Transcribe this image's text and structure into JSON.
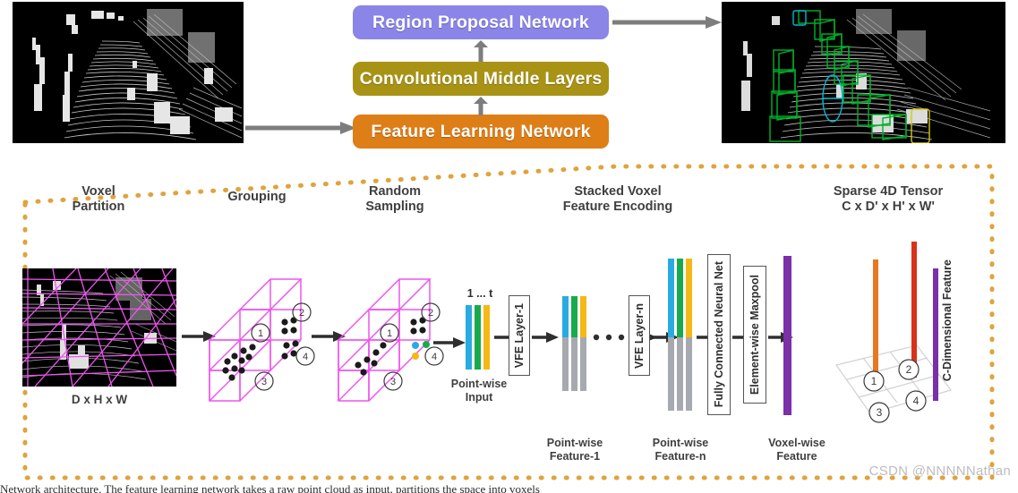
{
  "pipeline": {
    "boxes": [
      {
        "id": "region-proposal-network",
        "label": "Region Proposal Network",
        "color": "#8b85e8"
      },
      {
        "id": "convolutional-middle-layers",
        "label": "Convolutional Middle Layers",
        "color": "#a99315"
      },
      {
        "id": "feature-learning-network",
        "label": "Feature Learning Network",
        "color": "#de7e16"
      }
    ],
    "input_image_alt": "LiDAR point cloud input",
    "output_image_alt": "LiDAR point cloud with detected 3D bounding boxes"
  },
  "panel": {
    "border_color": "#e0a33c",
    "sections": [
      {
        "id": "voxel-partition",
        "title": "Voxel\nPartition",
        "caption": "D x H x W"
      },
      {
        "id": "grouping",
        "title": "Grouping",
        "caption": ""
      },
      {
        "id": "random-sampling",
        "title": "Random\nSampling",
        "caption": ""
      },
      {
        "id": "stacked-voxel-feature-encoding",
        "title": "Stacked Voxel\nFeature Encoding",
        "caption": ""
      },
      {
        "id": "sparse-4d-tensor",
        "title": "Sparse 4D Tensor\nC x D' x H' x W'",
        "caption": ""
      }
    ],
    "pointwise_input": {
      "range_label": "1 ... t",
      "caption": "Point-wise\nInput"
    },
    "vfe_layers": [
      {
        "id": "vfe-layer-1",
        "label": "VFE Layer-1"
      },
      {
        "id": "vfe-layer-n",
        "label": "VFE Layer-n"
      }
    ],
    "feature_captions": [
      {
        "id": "point-wise-feature-1",
        "text": "Point-wise\nFeature-1"
      },
      {
        "id": "point-wise-feature-n",
        "text": "Point-wise\nFeature-n"
      },
      {
        "id": "voxel-wise-feature",
        "text": "Voxel-wise\nFeature"
      }
    ],
    "fc_label": "Fully Connected Neural Net",
    "maxpool_label": "Element-wise Maxpool",
    "c_dimensional_label": "C-Dimensional Feature",
    "voxel_indices": [
      "1",
      "2",
      "3",
      "4"
    ],
    "tensor_indices": [
      "1",
      "2",
      "3",
      "4"
    ],
    "colors": {
      "voxel_grid": "#ee55ee",
      "bar_cyan": "#29abe2",
      "bar_green": "#18aa4c",
      "bar_yellow": "#f5b915",
      "bar_gray": "#a6aab0",
      "voxel_feature_purple": "#7b2fa8",
      "tensor_orange": "#e87722",
      "tensor_red": "#d8331a",
      "tensor_purple": "#7b2fa8"
    }
  },
  "watermark": {
    "text": "CSDN @NNNNNathan"
  },
  "bottom_caption": {
    "text": "Network architecture.  The feature learning network takes a raw point cloud as input, partitions the space into voxels"
  }
}
